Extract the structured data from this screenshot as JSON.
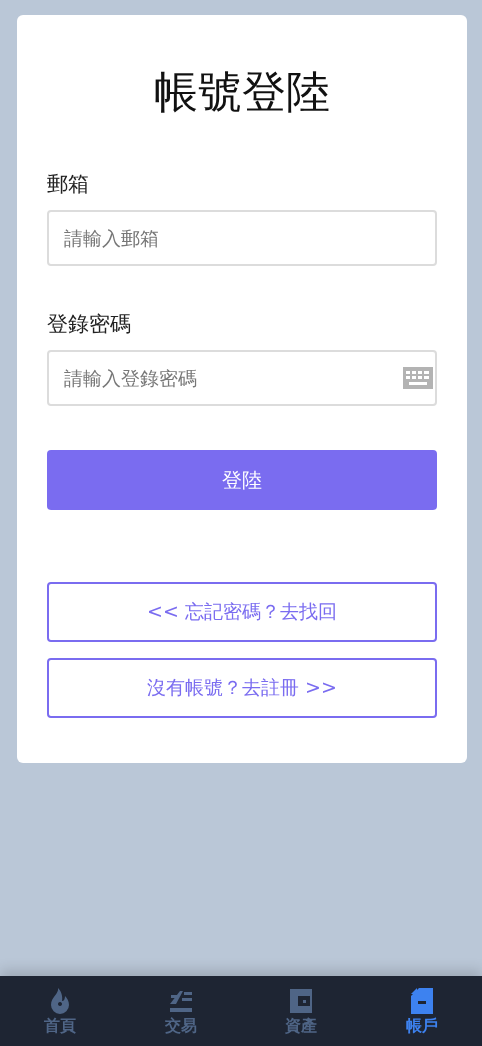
{
  "title": "帳號登陸",
  "fields": [
    {
      "label": "郵箱",
      "placeholder": "請輸入郵箱",
      "kind": "text"
    },
    {
      "label": "登錄密碼",
      "placeholder": "請輸入登錄密碼",
      "kind": "password"
    }
  ],
  "submit": "登陸",
  "links": [
    "<< 忘記密碼？去找回",
    "沒有帳號？去註冊 >>"
  ],
  "tabs": [
    {
      "label": "首頁",
      "selected": false
    },
    {
      "label": "交易",
      "selected": false
    },
    {
      "label": "資產",
      "selected": false
    },
    {
      "label": "帳戶",
      "selected": true
    }
  ]
}
